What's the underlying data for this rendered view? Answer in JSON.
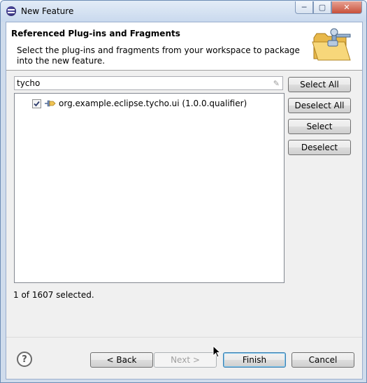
{
  "window": {
    "title": "New Feature",
    "controls": [
      "minimize",
      "maximize",
      "close"
    ]
  },
  "header": {
    "title": "Referenced Plug-ins and Fragments",
    "description": "Select the plug-ins and fragments from your workspace to package into the new feature."
  },
  "filter": {
    "value": "tycho"
  },
  "tree": {
    "items": [
      {
        "label": "org.example.eclipse.tycho.ui (1.0.0.qualifier)",
        "checked": true
      }
    ]
  },
  "side_buttons": {
    "select_all": "Select All",
    "deselect_all": "Deselect All",
    "select": "Select",
    "deselect": "Deselect"
  },
  "status": {
    "text": "1 of 1607 selected."
  },
  "footer": {
    "help_label": "?",
    "back": "< Back",
    "next": "Next >",
    "finish": "Finish",
    "cancel": "Cancel"
  }
}
